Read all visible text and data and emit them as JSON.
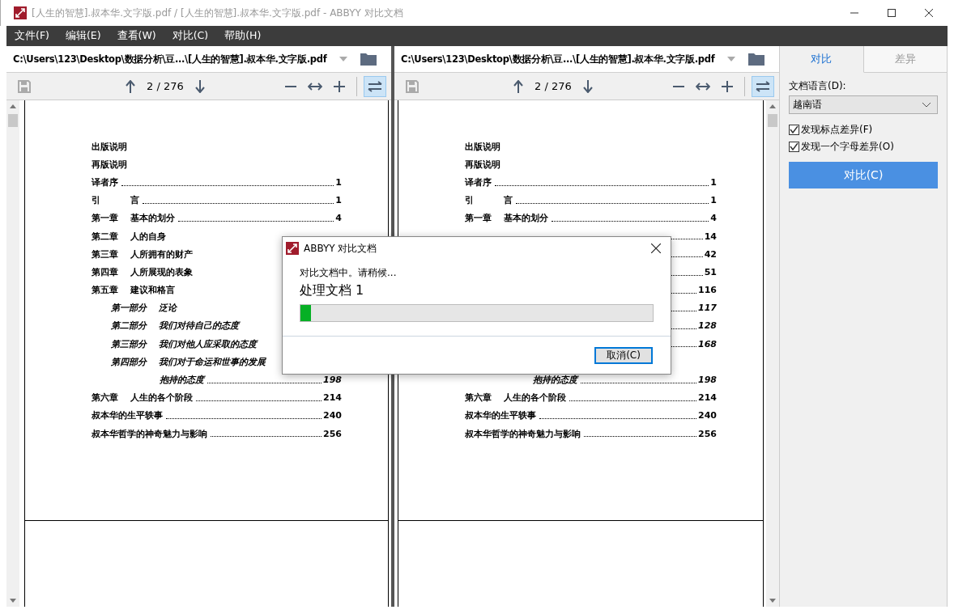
{
  "window": {
    "title": "[人生的智慧].叔本华.文字版.pdf / [人生的智慧].叔本华.文字版.pdf - ABBYY 对比文档"
  },
  "menu": [
    "文件(F)",
    "编辑(E)",
    "查看(W)",
    "对比(C)",
    "帮助(H)"
  ],
  "panes": [
    {
      "path": "C:\\Users\\123\\Desktop\\数据分析\\豆...\\[人生的智慧].叔本华.文字版.pdf",
      "page_indicator": "2 / 276",
      "sync_on": true,
      "toc": [
        {
          "kind": "front",
          "title": "出版说明"
        },
        {
          "kind": "front",
          "title": "再版说明"
        },
        {
          "kind": "front",
          "title": "译者序",
          "page": "1"
        },
        {
          "kind": "chapter",
          "label": "引",
          "title": "言",
          "page": "1"
        },
        {
          "kind": "chapter",
          "label": "第一章",
          "title": "基本的划分",
          "page": "4"
        },
        {
          "kind": "chapter",
          "label": "第二章",
          "title": "人的自身"
        },
        {
          "kind": "chapter",
          "label": "第三章",
          "title": "人所拥有的财产"
        },
        {
          "kind": "chapter",
          "label": "第四章",
          "title": "人所展现的表象"
        },
        {
          "kind": "chapter",
          "label": "第五章",
          "title": "建议和格言"
        },
        {
          "kind": "part",
          "label": "第一部分",
          "title": "泛论"
        },
        {
          "kind": "part",
          "label": "第二部分",
          "title": "我们对待自己的态度"
        },
        {
          "kind": "part",
          "label": "第三部分",
          "title": "我们对他人应采取的态度"
        },
        {
          "kind": "part",
          "label": "第四部分",
          "title": "我们对于命运和世事的发展"
        },
        {
          "kind": "cont",
          "title": "抱持的态度",
          "page": "198"
        },
        {
          "kind": "chapter",
          "label": "第六章",
          "title": "人生的各个阶段",
          "page": "214"
        },
        {
          "kind": "front",
          "title": "叔本华的生平轶事",
          "page": "240"
        },
        {
          "kind": "front",
          "title": "叔本华哲学的神奇魅力与影响",
          "page": "256"
        }
      ]
    },
    {
      "path": "C:\\Users\\123\\Desktop\\数据分析\\豆...\\[人生的智慧].叔本华.文字版.pdf",
      "page_indicator": "2 / 276",
      "sync_on": true,
      "toc": [
        {
          "kind": "front",
          "title": "出版说明"
        },
        {
          "kind": "front",
          "title": "再版说明"
        },
        {
          "kind": "front",
          "title": "译者序",
          "page": "1"
        },
        {
          "kind": "chapter",
          "label": "引",
          "title": "言",
          "page": "1"
        },
        {
          "kind": "chapter",
          "label": "第一章",
          "title": "基本的划分",
          "page": "4"
        },
        {
          "kind": "chapter",
          "page": "14"
        },
        {
          "kind": "chapter",
          "page": "42"
        },
        {
          "kind": "chapter",
          "page": "51"
        },
        {
          "kind": "chapter",
          "page": "116"
        },
        {
          "kind": "part",
          "page": "117"
        },
        {
          "kind": "part",
          "page": "128"
        },
        {
          "kind": "part",
          "page": "168"
        },
        {
          "kind": "part"
        },
        {
          "kind": "cont",
          "title": "抱持的态度",
          "page": "198"
        },
        {
          "kind": "chapter",
          "label": "第六章",
          "title": "人生的各个阶段",
          "page": "214"
        },
        {
          "kind": "front",
          "title": "叔本华的生平轶事",
          "page": "240"
        },
        {
          "kind": "front",
          "title": "叔本华哲学的神奇魅力与影响",
          "page": "256"
        }
      ]
    }
  ],
  "sidebar": {
    "tabs": [
      {
        "label": "对比",
        "selected": true
      },
      {
        "label": "差异",
        "selected": false
      }
    ],
    "language_label": "文档语言(D):",
    "language": "越南语",
    "options": [
      {
        "label": "发现标点差异(F)",
        "checked": true
      },
      {
        "label": "发现一个字母差异(O)",
        "checked": true
      }
    ],
    "compare_button": "对比(C)"
  },
  "dialog": {
    "title": "ABBYY 对比文档",
    "message": "对比文档中。请稍候...",
    "status": "处理文档 1",
    "level": 0.03,
    "cancel_button": "取消(C)"
  }
}
